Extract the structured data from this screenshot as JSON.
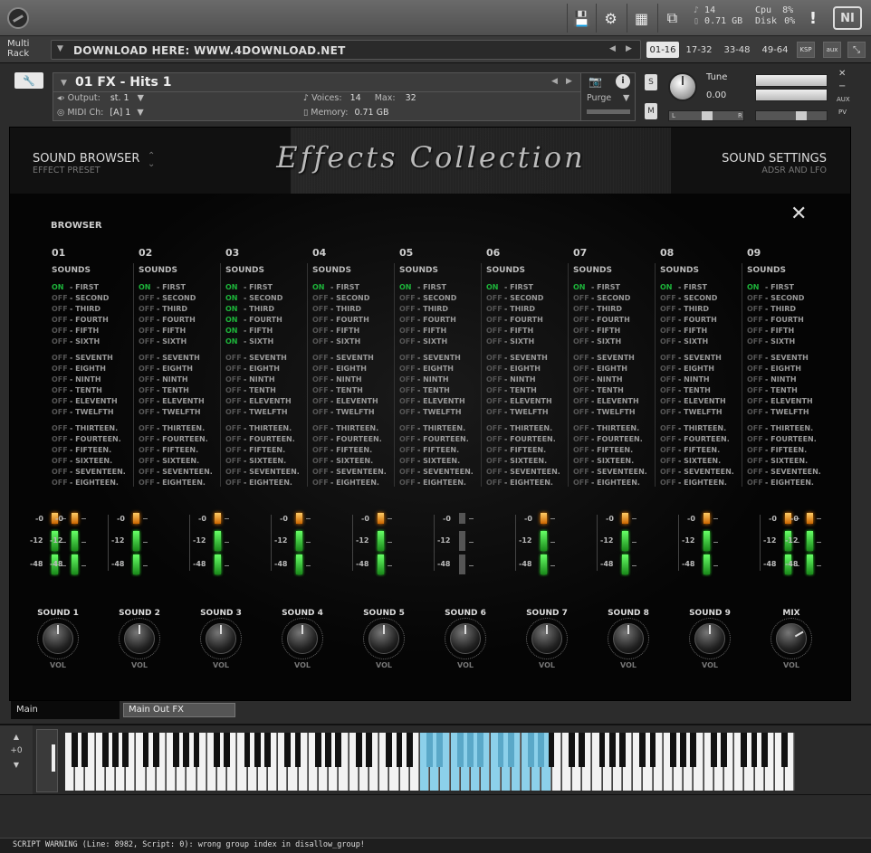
{
  "toolbar": {
    "stats_a": [
      "14",
      "0.71 GB"
    ],
    "stats_b_labels": [
      "Cpu",
      "Disk"
    ],
    "stats_b_values": [
      "8%",
      "0%"
    ],
    "warning_glyph": "!",
    "ni_logo": "NI"
  },
  "rack": {
    "label": "Multi Rack",
    "title": "DOWNLOAD HERE: WWW.4DOWNLOAD.NET",
    "tabs": [
      "01-16",
      "17-32",
      "33-48",
      "49-64"
    ],
    "ksp": "KSP",
    "aux": "aux"
  },
  "instrument": {
    "name": "01 FX - Hits 1",
    "output_label": "Output:",
    "output_value": "st. 1",
    "voices_label": "Voices:",
    "voices_value": "14",
    "max_label": "Max:",
    "max_value": "32",
    "purge": "Purge",
    "midi_label": "MIDI Ch:",
    "midi_value": "[A]  1",
    "memory_label": "Memory:",
    "memory_value": "0.71 GB",
    "s_btn": "S",
    "m_btn": "M",
    "tune_label": "Tune",
    "tune_value": "0.00",
    "pan_l": "L",
    "pan_r": "R",
    "aux_lbl": "AUX",
    "pv_lbl": "PV"
  },
  "panel": {
    "title": "Effects Collection",
    "left_main": "SOUND BROWSER",
    "left_sub": "EFFECT PRESET",
    "right_main": "SOUND SETTINGS",
    "right_sub": "ADSR AND LFO",
    "browser_label": "BROWSER",
    "close_glyph": "✕",
    "sounds_header": "SOUNDS",
    "columns": [
      {
        "num": "01",
        "on_index": 0
      },
      {
        "num": "02",
        "on_index": 0
      },
      {
        "num": "03",
        "on_index": 0
      },
      {
        "num": "04",
        "on_index": 0
      },
      {
        "num": "05",
        "on_index": 0
      },
      {
        "num": "06",
        "on_index": 0
      },
      {
        "num": "07",
        "on_index": 0
      },
      {
        "num": "08",
        "on_index": 0
      },
      {
        "num": "09",
        "on_index": 0
      }
    ],
    "col3_extra_on": [
      1,
      2,
      3,
      4,
      5
    ],
    "sound_names": [
      "FIRST",
      "SECOND",
      "THIRD",
      "FOURTH",
      "FIFTH",
      "SIXTH",
      "SEVENTH",
      "EIGHTH",
      "NINTH",
      "TENTH",
      "ELEVENTH",
      "TWELFTH",
      "THIRTEEN.",
      "FOURTEEN.",
      "FIFTEEN.",
      "SIXTEEN.",
      "SEVENTEEN.",
      "EIGHTEEN."
    ],
    "on_text": "ON",
    "off_text": "OFF",
    "meter_labels": [
      "-0",
      "-12",
      "-48"
    ],
    "knobs": [
      "SOUND 1",
      "SOUND 2",
      "SOUND 3",
      "SOUND 4",
      "SOUND 5",
      "SOUND 6",
      "SOUND 7",
      "SOUND 8",
      "SOUND 9",
      "MIX"
    ],
    "knob_sub": "VOL"
  },
  "bottom_tabs": {
    "main": "Main",
    "main_out": "Main Out FX"
  },
  "keyboard": {
    "octave": "+0"
  },
  "status": "SCRIPT WARNING (Line: 8982, Script: 0):   wrong group index in disallow_group!"
}
